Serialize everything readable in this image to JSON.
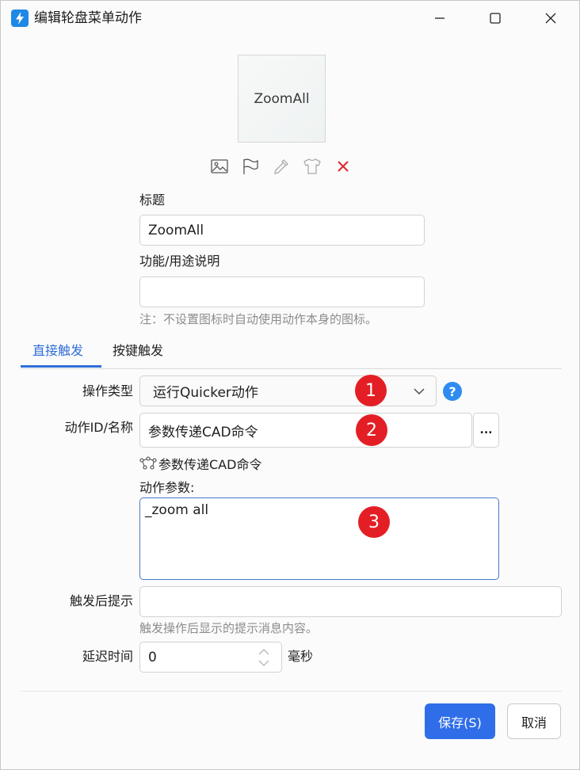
{
  "window": {
    "title": "编辑轮盘菜单动作"
  },
  "preview": {
    "text": "ZoomAll"
  },
  "icon_tools": [
    {
      "icon": "image-icon"
    },
    {
      "icon": "flag-icon"
    },
    {
      "icon": "eyedropper-icon"
    },
    {
      "icon": "tshirt-icon"
    },
    {
      "icon": "delete-icon"
    }
  ],
  "title_field": {
    "label": "标题",
    "value": "ZoomAll"
  },
  "description_field": {
    "label": "功能/用途说明",
    "value": "",
    "hint": "注：不设置图标时自动使用动作本身的图标。"
  },
  "tabs": [
    {
      "label": "直接触发",
      "active": true
    },
    {
      "label": "按键触发",
      "active": false
    }
  ],
  "operation_type": {
    "label": "操作类型",
    "value": "运行Quicker动作"
  },
  "action_id": {
    "label": "动作ID/名称",
    "value": "参数传递CAD命令",
    "browse_label": "...",
    "resolved_name": "参数传递CAD命令"
  },
  "action_params": {
    "label": "动作参数:",
    "value": "_zoom all"
  },
  "trigger_tip": {
    "label": "触发后提示",
    "value": "",
    "hint": "触发操作后显示的提示消息内容。"
  },
  "delay": {
    "label": "延迟时间",
    "value": "0",
    "unit": "毫秒"
  },
  "badges": [
    "1",
    "2",
    "3"
  ],
  "buttons": {
    "save": "保存(S)",
    "cancel": "取消"
  },
  "colors": {
    "accent": "#2f6ee8",
    "badge": "#e31f25",
    "help": "#2e8cf0",
    "delete": "#e0262b"
  }
}
